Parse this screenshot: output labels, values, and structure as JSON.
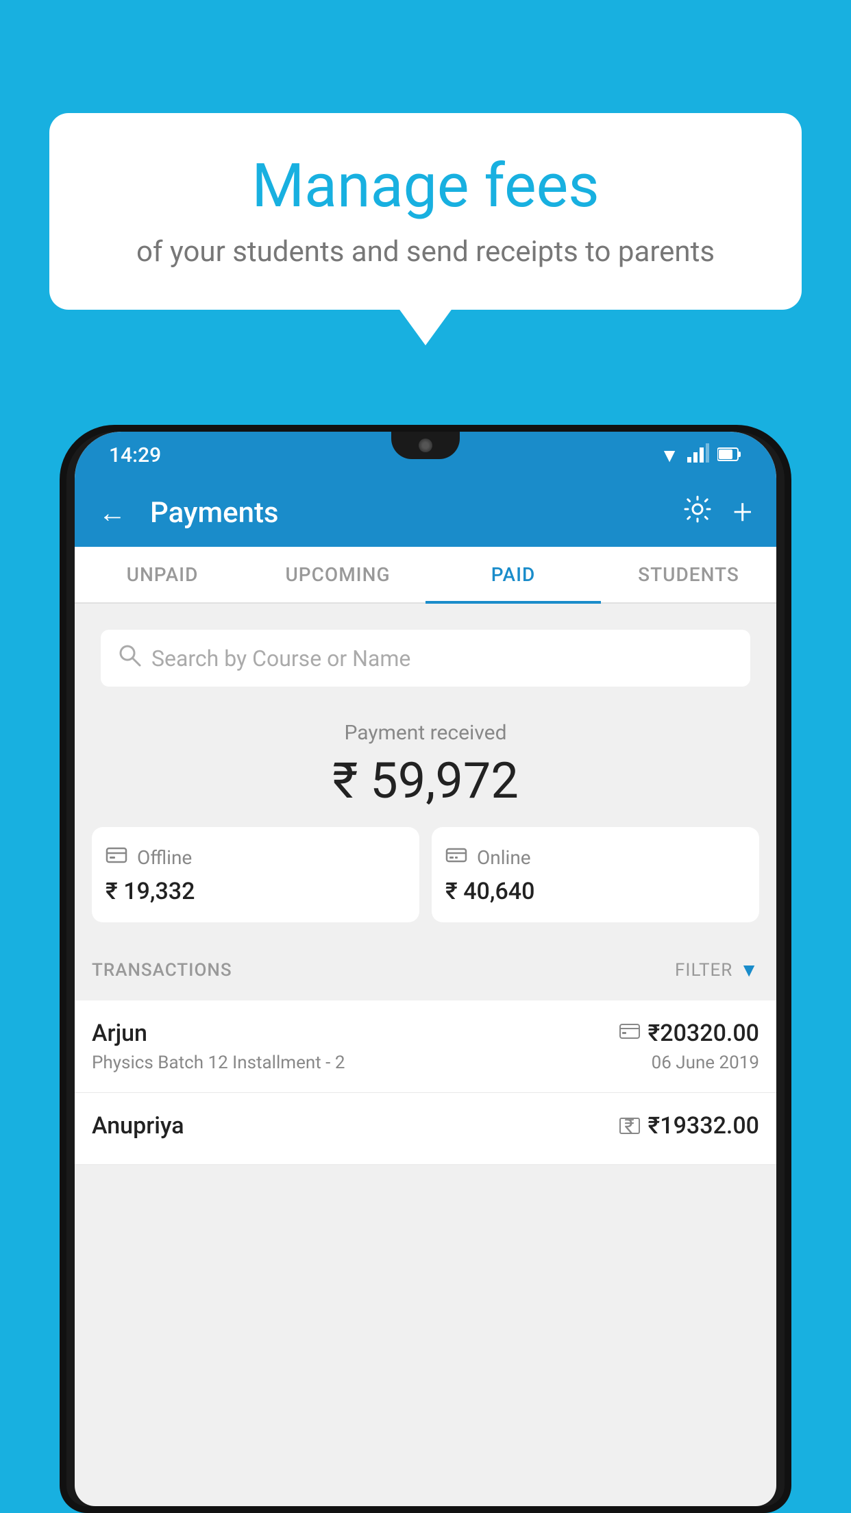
{
  "background_color": "#18b0e0",
  "bubble": {
    "title": "Manage fees",
    "subtitle": "of your students and send receipts to parents"
  },
  "status_bar": {
    "time": "14:29",
    "wifi_icon": "▾",
    "signal_icon": "▲",
    "battery_icon": "▮"
  },
  "app_bar": {
    "title": "Payments",
    "back_label": "←",
    "gear_label": "⚙",
    "plus_label": "+"
  },
  "tabs": [
    {
      "label": "UNPAID",
      "active": false
    },
    {
      "label": "UPCOMING",
      "active": false
    },
    {
      "label": "PAID",
      "active": true
    },
    {
      "label": "STUDENTS",
      "active": false
    }
  ],
  "search": {
    "placeholder": "Search by Course or Name"
  },
  "payment_summary": {
    "label": "Payment received",
    "amount": "₹ 59,972",
    "offline": {
      "icon": "💳",
      "label": "Offline",
      "amount": "₹ 19,332"
    },
    "online": {
      "icon": "💳",
      "label": "Online",
      "amount": "₹ 40,640"
    }
  },
  "transactions": {
    "header_label": "TRANSACTIONS",
    "filter_label": "FILTER",
    "items": [
      {
        "name": "Arjun",
        "method_icon": "💳",
        "amount": "₹20320.00",
        "detail": "Physics Batch 12 Installment - 2",
        "date": "06 June 2019"
      },
      {
        "name": "Anupriya",
        "method_icon": "₹",
        "amount": "₹19332.00",
        "detail": "",
        "date": ""
      }
    ]
  }
}
